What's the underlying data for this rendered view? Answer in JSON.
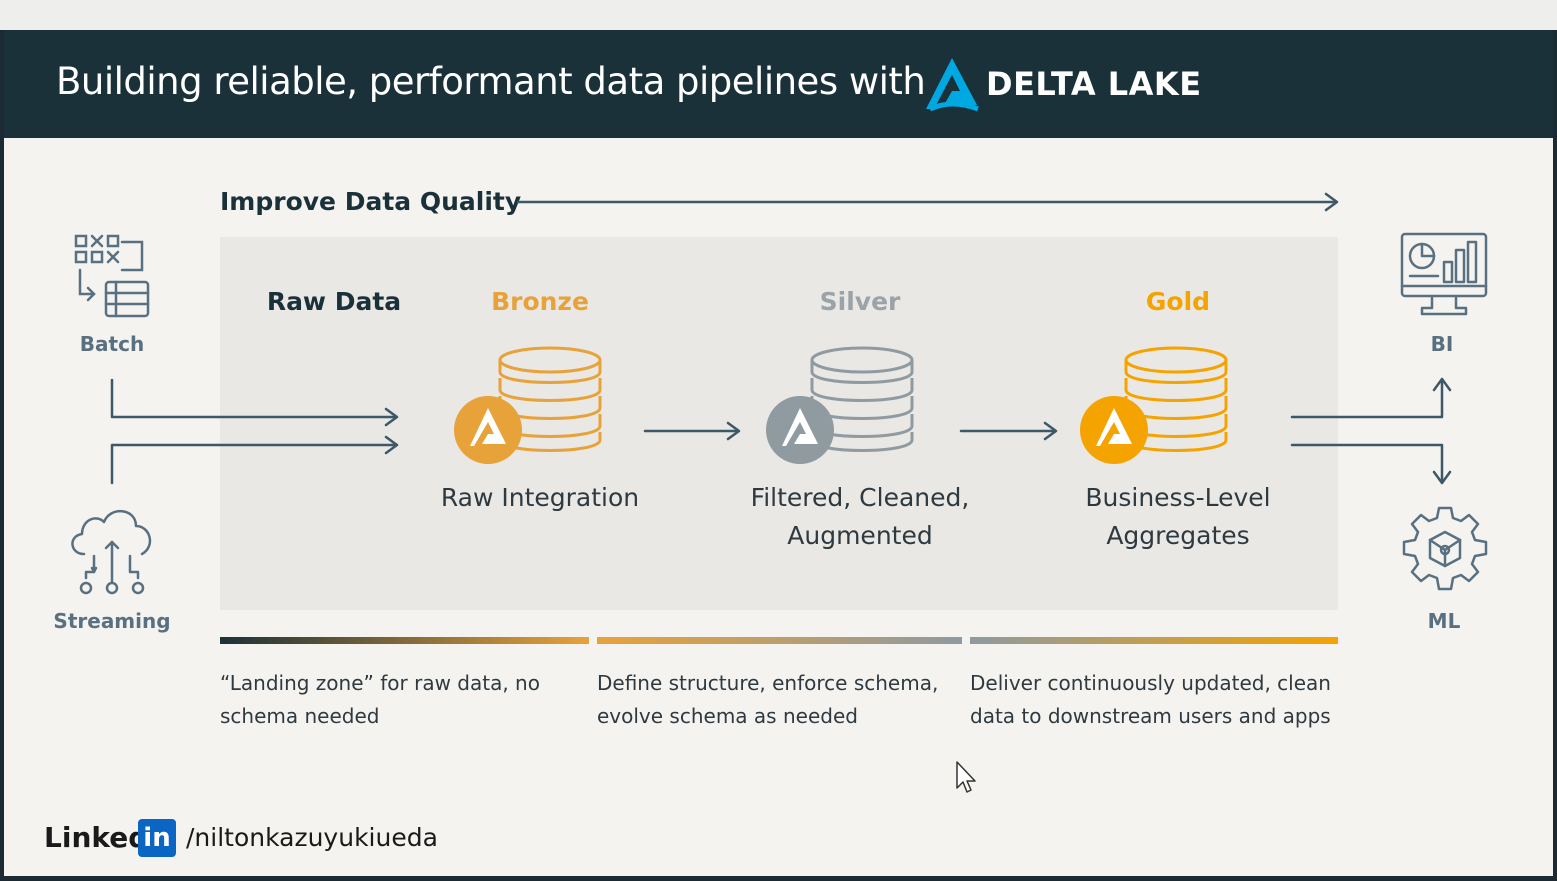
{
  "header": {
    "title": "Building reliable, performant data pipelines with",
    "brand": "DELTA LAKE"
  },
  "quality_label": "Improve Data Quality",
  "sources": {
    "batch": "Batch",
    "streaming": "Streaming"
  },
  "stages": {
    "raw": {
      "title": "Raw Data"
    },
    "bronze": {
      "title": "Bronze",
      "desc": "Raw Integration",
      "color": "#e8a23a"
    },
    "silver": {
      "title": "Silver",
      "desc": "Filtered, Cleaned, Augmented",
      "color": "#9aa3a8"
    },
    "gold": {
      "title": "Gold",
      "desc": "Business-Level Aggregates",
      "color": "#f5a300"
    }
  },
  "notes": {
    "n1": "“Landing zone” for raw data, no schema needed",
    "n2": "Define structure, enforce schema, evolve schema as needed",
    "n3": "Deliver continuously updated, clean data to downstream users and apps"
  },
  "outputs": {
    "bi": "BI",
    "ml": "ML"
  },
  "footer": {
    "linkedin_word": "Linked",
    "linkedin_in": "in",
    "handle": "/niltonkazuyukiueda"
  },
  "colors": {
    "dark": "#1b3139",
    "bronze": "#e8a23a",
    "silver": "#8f9aa1",
    "gold": "#f5a300",
    "slate": "#587080"
  }
}
